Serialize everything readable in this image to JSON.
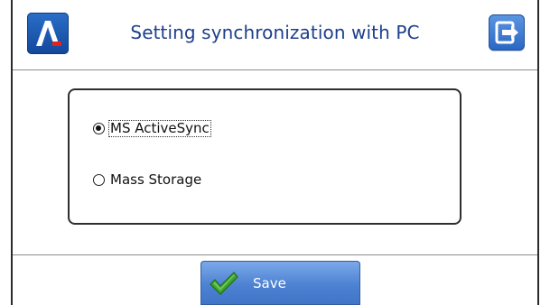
{
  "header": {
    "title": "Setting synchronization with PC",
    "logo_icon": "app-logo-a-icon",
    "exit_icon": "exit-arrow-icon"
  },
  "options": {
    "items": [
      {
        "label": "MS ActiveSync",
        "checked": true
      },
      {
        "label": "Mass Storage",
        "checked": false
      }
    ]
  },
  "footer": {
    "save_label": "Save",
    "save_icon": "checkmark-icon"
  },
  "colors": {
    "title": "#1e3f8c",
    "button_blue": "#4d82d2",
    "logo_blue": "#13479a",
    "logo_accent_red": "#e2231a",
    "check_green": "#3ea52b"
  }
}
